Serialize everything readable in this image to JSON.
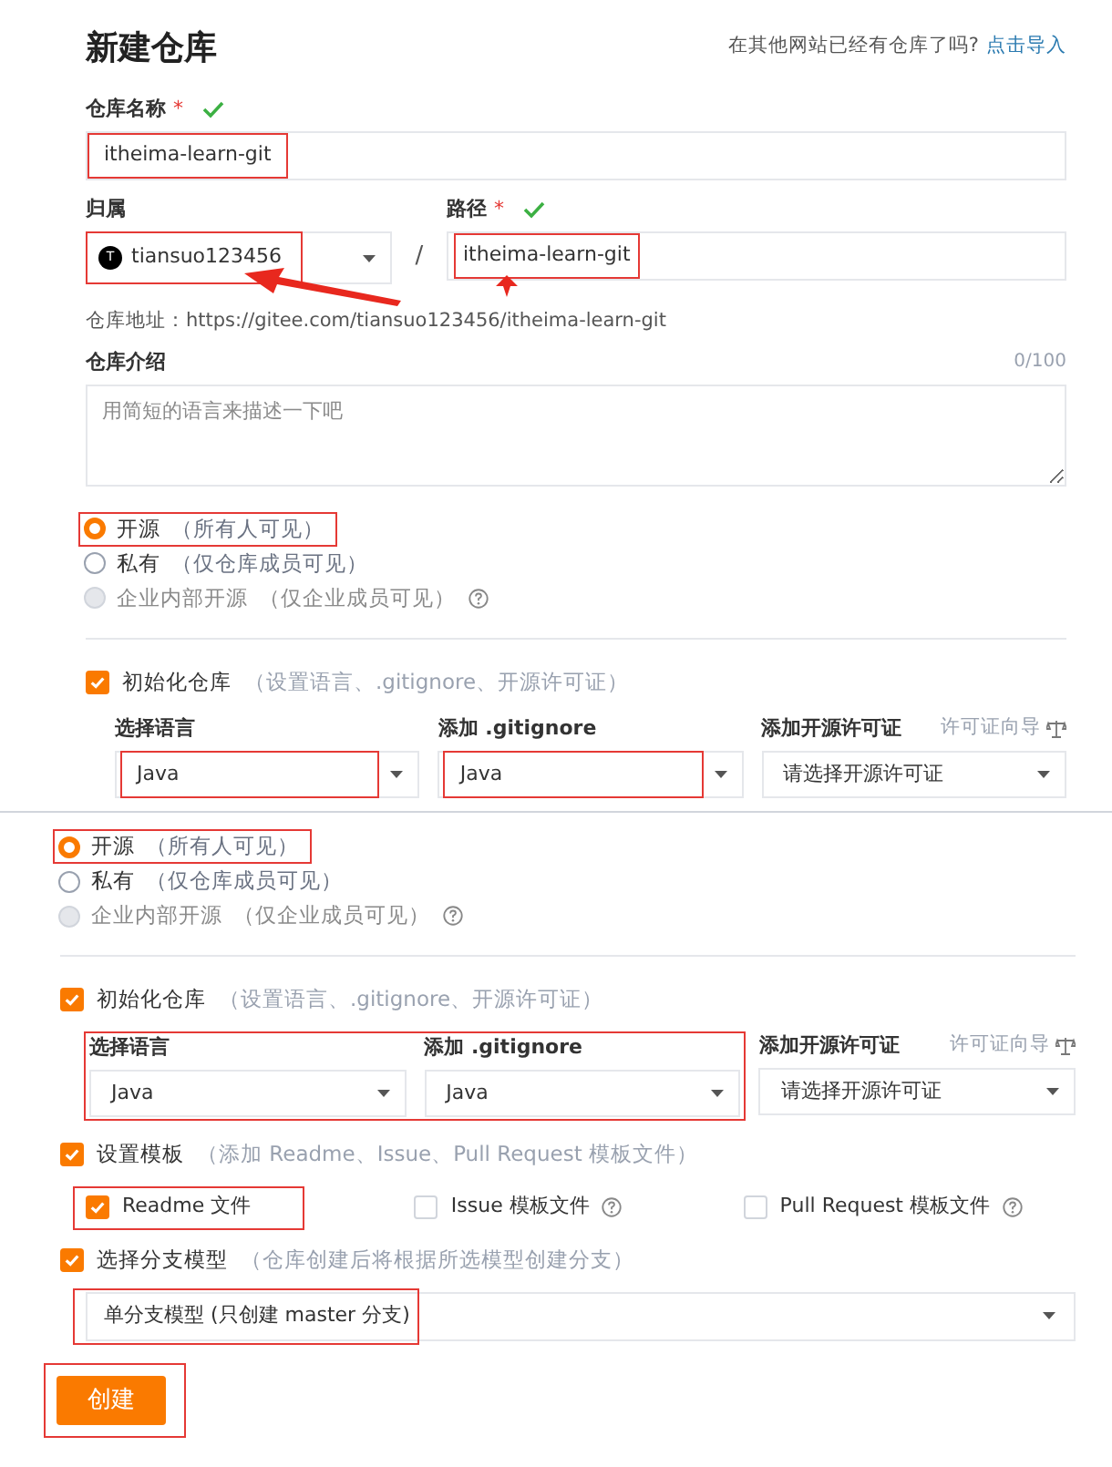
{
  "top": {
    "title": "新建仓库",
    "import_hint": "在其他网站已经有仓库了吗?",
    "import_link": "点击导入",
    "name_field": {
      "label": "仓库名称",
      "required_mark": "*",
      "valid": true,
      "value": "itheima-learn-git",
      "highlighted": true
    },
    "owner_field": {
      "label": "归属",
      "avatar": "T",
      "value": "tiansuo123456",
      "highlighted": true
    },
    "separator": "/",
    "path_field": {
      "label": "路径",
      "required_mark": "*",
      "valid": true,
      "value": "itheima-learn-git",
      "highlighted": true
    },
    "address": "仓库地址：https://gitee.com/tiansuo123456/itheima-learn-git",
    "description": {
      "label": "仓库介绍",
      "counter": "0/100",
      "placeholder": "用简短的语言来描述一下吧"
    },
    "visibility": [
      {
        "label": "开源",
        "note": "（所有人可见）",
        "selected": true,
        "disabled": false,
        "highlighted": true,
        "help": false
      },
      {
        "label": "私有",
        "note": "（仅仓库成员可见）",
        "selected": false,
        "disabled": false,
        "highlighted": false,
        "help": false
      },
      {
        "label": "企业内部开源",
        "note": "（仅企业成员可见）",
        "selected": false,
        "disabled": true,
        "highlighted": false,
        "help": true
      }
    ],
    "init": {
      "label": "初始化仓库",
      "note": "（设置语言、.gitignore、开源许可证）",
      "checked": true
    },
    "selects_group_highlighted": false,
    "selects": [
      {
        "label": "选择语言",
        "value": "Java",
        "highlighted": true
      },
      {
        "label": "添加 .gitignore",
        "value": "Java",
        "highlighted": true
      },
      {
        "label": "添加开源许可证",
        "value": "请选择开源许可证",
        "highlighted": false,
        "guide": "许可证向导"
      }
    ]
  },
  "bottom": {
    "visibility": [
      {
        "label": "开源",
        "note": "（所有人可见）",
        "selected": true,
        "disabled": false,
        "highlighted": true,
        "help": false
      },
      {
        "label": "私有",
        "note": "（仅仓库成员可见）",
        "selected": false,
        "disabled": false,
        "highlighted": false,
        "help": false
      },
      {
        "label": "企业内部开源",
        "note": "（仅企业成员可见）",
        "selected": false,
        "disabled": true,
        "highlighted": false,
        "help": true
      }
    ],
    "init": {
      "label": "初始化仓库",
      "note": "（设置语言、.gitignore、开源许可证）",
      "checked": true
    },
    "selects_group_highlighted": true,
    "selects": [
      {
        "label": "选择语言",
        "value": "Java",
        "highlighted": false
      },
      {
        "label": "添加 .gitignore",
        "value": "Java",
        "highlighted": false
      },
      {
        "label": "添加开源许可证",
        "value": "请选择开源许可证",
        "highlighted": false,
        "guide": "许可证向导"
      }
    ],
    "template": {
      "label": "设置模板",
      "note": "（添加 Readme、Issue、Pull Request 模板文件）",
      "checked": true,
      "options": [
        {
          "label": "Readme 文件",
          "checked": true,
          "highlighted": true,
          "help": false
        },
        {
          "label": "Issue 模板文件",
          "checked": false,
          "highlighted": false,
          "help": true
        },
        {
          "label": "Pull Request 模板文件",
          "checked": false,
          "highlighted": false,
          "help": true
        }
      ]
    },
    "branch": {
      "label": "选择分支模型",
      "note": "（仓库创建后将根据所选模型创建分支）",
      "checked": true,
      "value": "单分支模型 (只创建 master 分支)",
      "highlighted": true
    },
    "create_button": {
      "label": "创建",
      "highlighted": true
    }
  }
}
